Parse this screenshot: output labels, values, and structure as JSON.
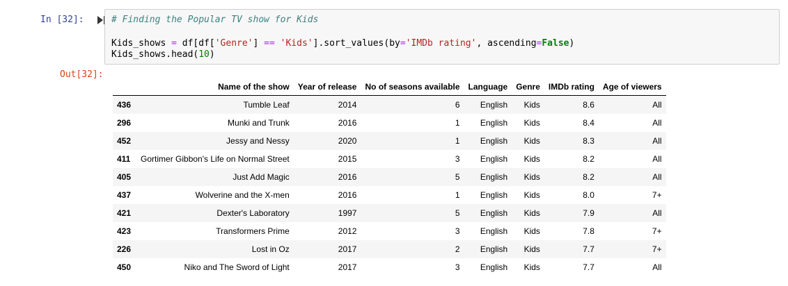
{
  "cell": {
    "in_prompt": "In [32]:",
    "out_prompt": "Out[32]:",
    "code_comment": "# Finding the Popular TV show for Kids",
    "code_line2": {
      "a": "Kids_shows ",
      "b": "=",
      "c": " df[df[",
      "d": "'Genre'",
      "e": "] ",
      "f": "==",
      "g": " ",
      "h": "'Kids'",
      "i": "].sort_values(by",
      "j": "=",
      "k": "'IMDb rating'",
      "l": ", ascending",
      "m": "=",
      "n": "False",
      "o": ")"
    },
    "code_line3": {
      "a": "Kids_shows.head(",
      "b": "10",
      "c": ")"
    }
  },
  "table": {
    "columns": [
      "Name of the show",
      "Year of release",
      "No of seasons available",
      "Language",
      "Genre",
      "IMDb rating",
      "Age of viewers"
    ],
    "rows": [
      {
        "index": "436",
        "name": "Tumble Leaf",
        "year": "2014",
        "seasons": "6",
        "language": "English",
        "genre": "Kids",
        "rating": "8.6",
        "age": "All"
      },
      {
        "index": "296",
        "name": "Munki and Trunk",
        "year": "2016",
        "seasons": "1",
        "language": "English",
        "genre": "Kids",
        "rating": "8.4",
        "age": "All"
      },
      {
        "index": "452",
        "name": "Jessy and Nessy",
        "year": "2020",
        "seasons": "1",
        "language": "English",
        "genre": "Kids",
        "rating": "8.3",
        "age": "All"
      },
      {
        "index": "411",
        "name": "Gortimer Gibbon's Life on Normal Street",
        "year": "2015",
        "seasons": "3",
        "language": "English",
        "genre": "Kids",
        "rating": "8.2",
        "age": "All"
      },
      {
        "index": "405",
        "name": "Just Add Magic",
        "year": "2016",
        "seasons": "5",
        "language": "English",
        "genre": "Kids",
        "rating": "8.2",
        "age": "All"
      },
      {
        "index": "437",
        "name": "Wolverine and the X-men",
        "year": "2016",
        "seasons": "1",
        "language": "English",
        "genre": "Kids",
        "rating": "8.0",
        "age": "7+"
      },
      {
        "index": "421",
        "name": "Dexter's Laboratory",
        "year": "1997",
        "seasons": "5",
        "language": "English",
        "genre": "Kids",
        "rating": "7.9",
        "age": "All"
      },
      {
        "index": "423",
        "name": "Transformers Prime",
        "year": "2012",
        "seasons": "3",
        "language": "English",
        "genre": "Kids",
        "rating": "7.8",
        "age": "7+"
      },
      {
        "index": "226",
        "name": "Lost in Oz",
        "year": "2017",
        "seasons": "2",
        "language": "English",
        "genre": "Kids",
        "rating": "7.7",
        "age": "7+"
      },
      {
        "index": "450",
        "name": "Niko and The Sword of Light",
        "year": "2017",
        "seasons": "3",
        "language": "English",
        "genre": "Kids",
        "rating": "7.7",
        "age": "All"
      }
    ]
  },
  "icons": {
    "run": "run-cell-icon"
  },
  "colors": {
    "in_prompt": "#303f9f",
    "out_prompt": "#d84315",
    "comment": "#408080",
    "string": "#ba2121",
    "operator": "#aa22ff",
    "keyword": "#008000",
    "cell_background": "#f7f7f7",
    "row_stripe": "#f5f5f5"
  }
}
